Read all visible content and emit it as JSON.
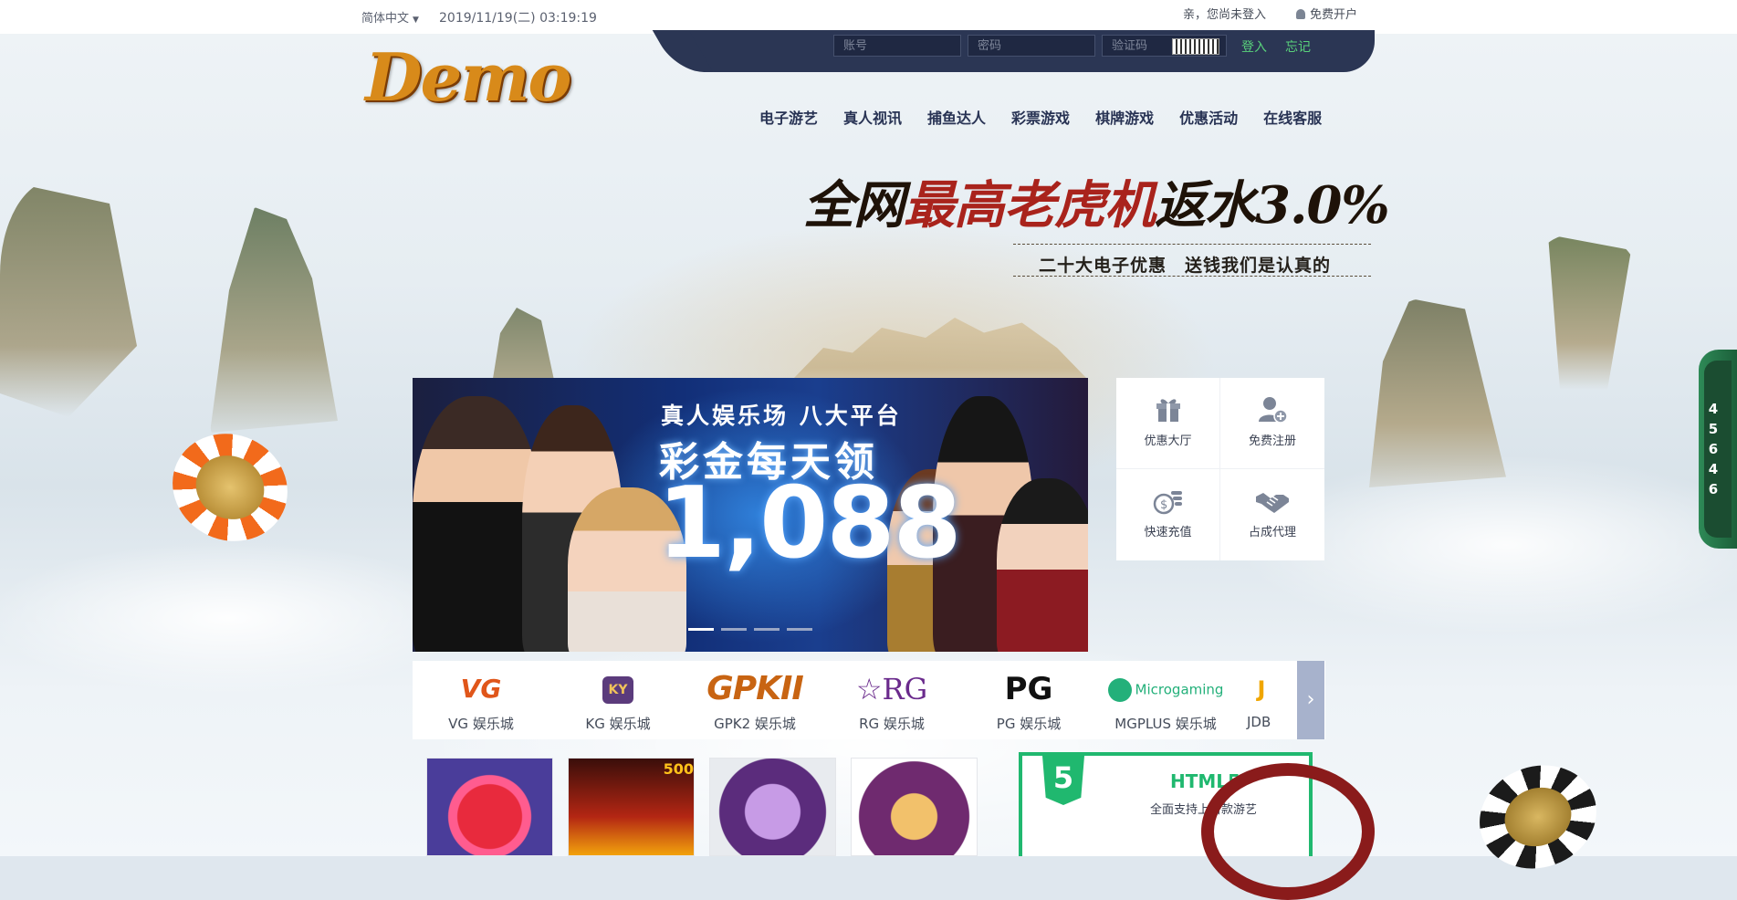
{
  "topbar": {
    "language": "简体中文",
    "datetime": "2019/11/19(二) 03:19:19",
    "greeting": "亲，您尚未登入",
    "register_link": "免费开户"
  },
  "login": {
    "username_placeholder": "账号",
    "password_placeholder": "密码",
    "captcha_placeholder": "验证码",
    "login_button": "登入",
    "forgot_button": "忘记"
  },
  "brand": {
    "logo_text": "Demo"
  },
  "nav": {
    "items": [
      {
        "label": "电子游艺"
      },
      {
        "label": "真人视讯"
      },
      {
        "label": "捕鱼达人"
      },
      {
        "label": "彩票游戏"
      },
      {
        "label": "棋牌游戏"
      },
      {
        "label": "优惠活动"
      },
      {
        "label": "在线客服"
      }
    ]
  },
  "hero": {
    "headline_a": "全网",
    "headline_b": "最高老虎机",
    "headline_c": "返水3.0%",
    "subline": "二十大电子优惠　送钱我们是认真的"
  },
  "banner": {
    "title": "真人娱乐场 八大平台",
    "subtitle": "彩金每天领",
    "amount": "1,088",
    "slides_total": 4,
    "slides_active": 1
  },
  "quick_links": [
    {
      "label": "优惠大厅",
      "icon": "gift-icon"
    },
    {
      "label": "免费注册",
      "icon": "user-plus-icon"
    },
    {
      "label": "快速充值",
      "icon": "coins-icon"
    },
    {
      "label": "占成代理",
      "icon": "handshake-icon"
    }
  ],
  "providers": [
    {
      "logo": "VG",
      "name": "VG 娱乐城",
      "color": "#e0561a"
    },
    {
      "logo": "KY",
      "name": "KG 娱乐城",
      "color": "#c58a19"
    },
    {
      "logo": "GPKII",
      "name": "GPK2 娱乐城",
      "color": "#c86412"
    },
    {
      "logo": "☆RG",
      "name": "RG 娱乐城",
      "color": "#6a2a8c"
    },
    {
      "logo": "PG",
      "name": "PG 娱乐城",
      "color": "#111111"
    },
    {
      "logo": "Microgaming",
      "name": "MGPLUS 娱乐城",
      "color": "#23b07a"
    },
    {
      "logo": "J",
      "name": "JDB",
      "color": "#f0a600"
    }
  ],
  "games": {
    "tag": "500"
  },
  "html5_promo": {
    "badge": "5",
    "title": "HTML5",
    "text": "全面支持上百款游艺"
  },
  "sidetab": {
    "digits": "45646"
  }
}
